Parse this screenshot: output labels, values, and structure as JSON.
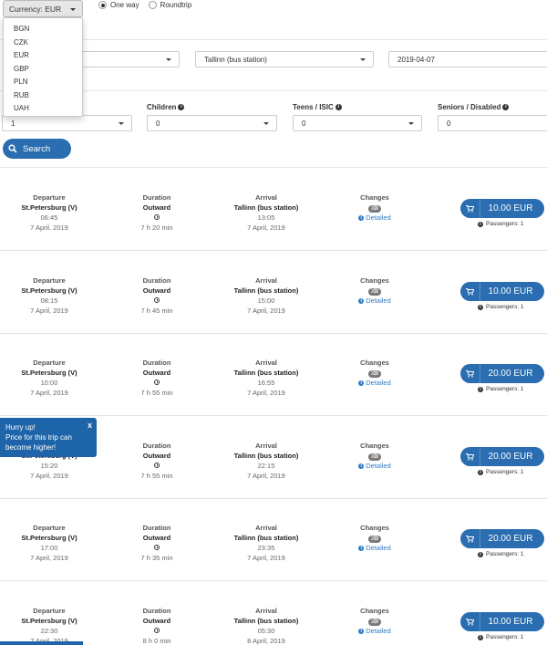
{
  "currency": {
    "button_label": "Currency: EUR",
    "options": [
      "BGN",
      "CZK",
      "EUR",
      "GBP",
      "PLN",
      "RUB",
      "UAH"
    ]
  },
  "trip_type": {
    "one_way": "One way",
    "roundtrip": "Roundtrip",
    "selected": "One way"
  },
  "route": {
    "to": "Tallinn (bus station)",
    "date": "2019-04-07"
  },
  "passengers": {
    "adults_value": "1",
    "children_label": "Children",
    "children_value": "0",
    "teens_label": "Teens / ISIC",
    "teens_value": "0",
    "seniors_label": "Seniors / Disabled",
    "seniors_value": "0"
  },
  "search_label": "Search",
  "headers": {
    "departure": "Departure",
    "duration": "Duration",
    "arrival": "Arrival",
    "changes": "Changes"
  },
  "trips": [
    {
      "from": "St.Petersburg (V)",
      "dep_time": "06:45",
      "dep_date": "7 April, 2019",
      "dir": "Outward",
      "duration": "7 h 20 min",
      "to": "Tallinn (bus station)",
      "arr_time": "13:05",
      "arr_date": "7 April, 2019",
      "changes": "0",
      "detail": "Detailed",
      "price": "10.00 EUR",
      "passengers": "Passengers: 1"
    },
    {
      "from": "St.Petersburg (V)",
      "dep_time": "08:15",
      "dep_date": "7 April, 2019",
      "dir": "Outward",
      "duration": "7 h 45 min",
      "to": "Tallinn (bus station)",
      "arr_time": "15:00",
      "arr_date": "7 April, 2019",
      "changes": "0",
      "detail": "Detailed",
      "price": "10.00 EUR",
      "passengers": "Passengers: 1"
    },
    {
      "from": "St.Petersburg (V)",
      "dep_time": "10:00",
      "dep_date": "7 April, 2019",
      "dir": "Outward",
      "duration": "7 h 55 min",
      "to": "Tallinn (bus station)",
      "arr_time": "16:55",
      "arr_date": "7 April, 2019",
      "changes": "0",
      "detail": "Detailed",
      "price": "20.00 EUR",
      "passengers": "Passengers: 1"
    },
    {
      "from": "St.Petersburg (V)",
      "dep_time": "15:20",
      "dep_date": "7 April, 2019",
      "dir": "Outward",
      "duration": "7 h 55 min",
      "to": "Tallinn (bus station)",
      "arr_time": "22:15",
      "arr_date": "7 April, 2019",
      "changes": "0",
      "detail": "Detailed",
      "price": "20.00 EUR",
      "passengers": "Passengers: 1"
    },
    {
      "from": "St.Petersburg (V)",
      "dep_time": "17:00",
      "dep_date": "7 April, 2019",
      "dir": "Outward",
      "duration": "7 h 35 min",
      "to": "Tallinn (bus station)",
      "arr_time": "23:35",
      "arr_date": "7 April, 2019",
      "changes": "0",
      "detail": "Detailed",
      "price": "20.00 EUR",
      "passengers": "Passengers: 1"
    },
    {
      "from": "St.Petersburg (V)",
      "dep_time": "22:30",
      "dep_date": "7 April, 2019",
      "dir": "Outward",
      "duration": "8 h 0 min",
      "to": "Tallinn (bus station)",
      "arr_time": "05:30",
      "arr_date": "8 April, 2019",
      "changes": "0",
      "detail": "Detailed",
      "price": "10.00 EUR",
      "passengers": "Passengers: 1"
    }
  ],
  "hurry": {
    "title": "Hurry up!",
    "text": "Price for this trip can become higher!",
    "close": "x"
  },
  "colors": {
    "primary": "#2a6db0",
    "popup": "#1e64a8"
  }
}
